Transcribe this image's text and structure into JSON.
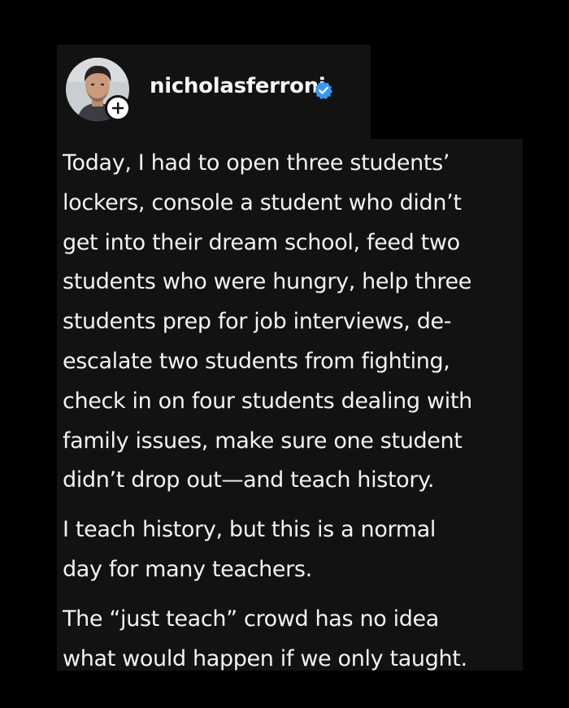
{
  "post": {
    "username": "nicholasferroni",
    "verified_icon": "verified-badge-icon",
    "follow_icon": "plus-icon",
    "colors": {
      "background": "#000000",
      "panel": "#121212",
      "text": "#f2f2f2",
      "verified_blue": "#3897f0"
    },
    "paragraphs": [
      {
        "lines": [
          "Today, I had to open three students’",
          "lockers, console a student who didn’t",
          "get into their dream school, feed two",
          "students who were hungry, help three",
          "students prep for job interviews, de-",
          "escalate two students from fighting,",
          "check in on four students dealing with",
          "family issues, make sure one student",
          "didn’t drop out—and teach history."
        ]
      },
      {
        "lines": [
          "I teach history, but this is a normal",
          "day for many teachers."
        ]
      },
      {
        "lines": [
          "The “just teach” crowd has no idea",
          "what would happen if we only taught."
        ]
      }
    ]
  }
}
